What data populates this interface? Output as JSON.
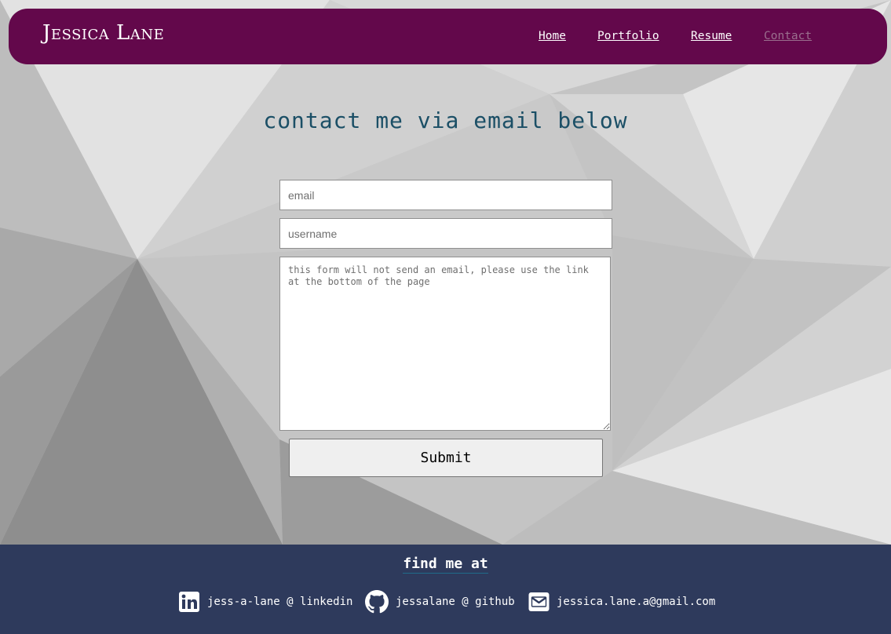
{
  "header": {
    "brand": "Jessica Lane",
    "nav": [
      {
        "label": "Home",
        "active": false
      },
      {
        "label": "Portfolio",
        "active": false
      },
      {
        "label": "Resume",
        "active": false
      },
      {
        "label": "Contact",
        "active": true
      }
    ]
  },
  "main": {
    "heading": "contact me via email below",
    "form": {
      "email_placeholder": "email",
      "username_placeholder": "username",
      "message_placeholder": "this form will not send an email, please use the link at the bottom of the page",
      "submit_label": "Submit"
    }
  },
  "footer": {
    "title": "find me at",
    "links": [
      {
        "icon": "linkedin-icon",
        "label": "jess-a-lane @ linkedin"
      },
      {
        "icon": "github-icon",
        "label": "jessalane @ github"
      },
      {
        "icon": "envelope-icon",
        "label": "jessica.lane.a@gmail.com"
      }
    ]
  },
  "colors": {
    "navbar": "#63084b",
    "heading": "#1b4f66",
    "footer": "#2e3a5c",
    "active_nav": "#9a6f8e"
  }
}
